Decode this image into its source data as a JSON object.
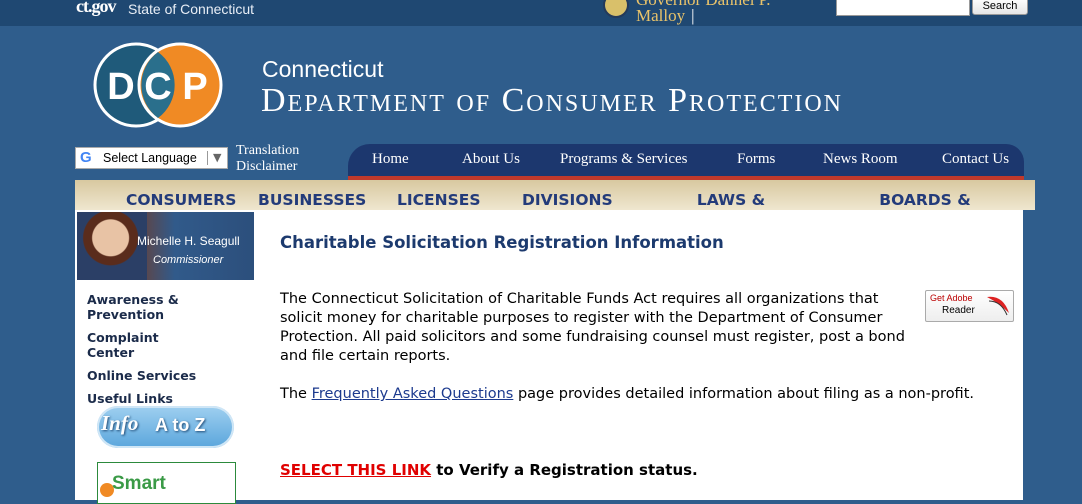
{
  "topbar": {
    "site_logo": "ct.gov",
    "state_name": "State of Connecticut",
    "governor_line1": "Governor Dannel P.",
    "governor_line2": "Malloy",
    "search_placeholder": "",
    "search_button": "Search"
  },
  "header": {
    "logo_text": "DCP",
    "logo_letters": [
      "D",
      "C",
      "P"
    ],
    "title_line1": "Connecticut",
    "title_line2": "Department of Consumer Protection"
  },
  "translate": {
    "select_label": "Select Language",
    "disclaimer": "Translation Disclaimer"
  },
  "nav": {
    "items": [
      "Home",
      "About Us",
      "Programs & Services",
      "Forms",
      "News Room",
      "Contact Us"
    ]
  },
  "categories": {
    "items": [
      "CONSUMERS",
      "BUSINESSES",
      "LICENSES",
      "DIVISIONS",
      "LAWS & REGULATIONS",
      "BOARDS & COMMISSIONS"
    ]
  },
  "sidebar": {
    "commissioner_name": "Michelle H. Seagull",
    "commissioner_title": "Commissioner",
    "links": [
      "Awareness & Prevention",
      "Complaint Center",
      "Online Services",
      "Useful Links"
    ],
    "info_label": "Info",
    "az_label": "A to Z",
    "smart_label": "Smart"
  },
  "main": {
    "title": "Charitable Solicitation Registration Information",
    "paragraph1": "The Connecticut Solicitation of Charitable Funds Act requires all organizations that solicit money for charitable purposes to register with the Department of Consumer Protection. All paid solicitors and some fundraising counsel must register, post a bond and file certain reports.",
    "paragraph2_prefix": "The ",
    "faq_link": "Frequently Asked Questions",
    "paragraph2_suffix": " page provides detailed information about filing as a non-profit.",
    "select_link": "SELECT THIS LINK",
    "verify_suffix": " to Verify a Registration status.",
    "adobe_get": "Get Adobe",
    "adobe_reader": "Reader"
  },
  "colors": {
    "page_bg": "#2f5d8c",
    "nav_bg": "#1c376e",
    "accent_red": "#c0392b",
    "logo_teal": "#1f5a7a",
    "logo_orange": "#f08a24",
    "link_red": "#e00000"
  }
}
